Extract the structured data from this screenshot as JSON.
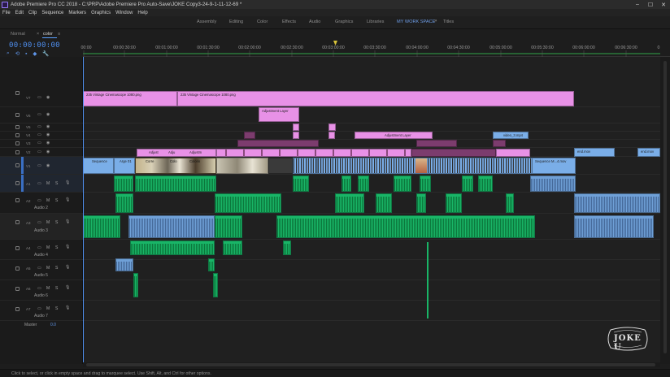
{
  "window": {
    "title": "Adobe Premiere Pro CC 2018 - C:\\PRP\\Adobe Premiere Pro Auto-Save\\JOKE Copy3-24-9-1-11-12-69 *",
    "controls": [
      "–",
      "☐",
      "✕"
    ]
  },
  "menu": [
    "File",
    "Edit",
    "Clip",
    "Sequence",
    "Markers",
    "Graphics",
    "Window",
    "Help"
  ],
  "workspaces": {
    "items": [
      "Assembly",
      "Editing",
      "Color",
      "Effects",
      "Audio",
      "Graphics",
      "Libraries",
      "MY WORK SPACE",
      "Titles"
    ],
    "active": "MY WORK SPACE",
    "more": "»"
  },
  "panel_tabs": {
    "tab1": "Normal",
    "close": "×",
    "tab2": "color",
    "menu": "≡"
  },
  "timecode": "00:00:00:00",
  "tools": [
    "⌕",
    "⟲",
    "▪",
    "◆",
    "🔧"
  ],
  "ruler": {
    "labels": [
      "00:00",
      "00:00:30:00",
      "00:01:00:00",
      "00:01:30:00",
      "00:02:00:00",
      "00:02:30:00",
      "00:03:00:00",
      "00:03:30:00",
      "00:04:00:00",
      "00:04:30:00",
      "00:05:00:00",
      "00:05:30:00",
      "00:06:00:00",
      "00:06:30:00",
      "0"
    ]
  },
  "video_tracks": [
    {
      "id": "V7",
      "label": "V7"
    },
    {
      "id": "V6",
      "label": "V6"
    },
    {
      "id": "V5",
      "label": "V5"
    },
    {
      "id": "V4",
      "label": "V4"
    },
    {
      "id": "V3",
      "label": "V3"
    },
    {
      "id": "V2",
      "label": "V2"
    },
    {
      "id": "V1",
      "label": "V1"
    }
  ],
  "audio_tracks": [
    {
      "id": "A1",
      "label": "A1",
      "name": "",
      "m": "M",
      "s": "S",
      "vol": "0"
    },
    {
      "id": "A2",
      "label": "A2",
      "name": "Audio 2",
      "m": "M",
      "s": "S",
      "vol": "0"
    },
    {
      "id": "A3",
      "label": "A3",
      "name": "Audio 3",
      "m": "M",
      "s": "S",
      "vol": "0"
    },
    {
      "id": "A4",
      "label": "A4",
      "name": "Audio 4",
      "m": "M",
      "s": "S",
      "vol": "0"
    },
    {
      "id": "A5",
      "label": "A5",
      "name": "Audio 5",
      "m": "M",
      "s": "S",
      "vol": "0"
    },
    {
      "id": "A6",
      "label": "A6",
      "name": "Audio 6",
      "m": "M",
      "s": "S",
      "vol": "0"
    },
    {
      "id": "A7",
      "label": "A7",
      "name": "Audio 7",
      "m": "M",
      "s": "S",
      "vol": "0"
    }
  ],
  "master": {
    "label": "Master",
    "value": "0.0"
  },
  "clips": {
    "v7_a": "235 Vintage Cinemascope 1080.png",
    "v7_b": "235 Vintage Cinemascope 1080.png",
    "v6_adj": "Adjustment Layer",
    "v3_adj": "Adjustment Layer",
    "v3_video": "video_3.mp4",
    "v2_adj1": "Adjust",
    "v2_adj2": "Adju",
    "v2_adj3": "Adjustm",
    "v1_seq1": "Sequence",
    "v1_img": "Arge 01",
    "v1_c1": "Corre",
    "v1_c2": "Colo",
    "v1_c3": "Colorin",
    "v1_seqmain": "Sequence M...4.mov",
    "v1_end1": "end.mov",
    "v1_end2": "end.mov"
  },
  "status": "Click to select, or click in empty space and drag to marquee select. Use Shift, Alt, and Ctrl for other options.",
  "watermark": "JOKE U"
}
